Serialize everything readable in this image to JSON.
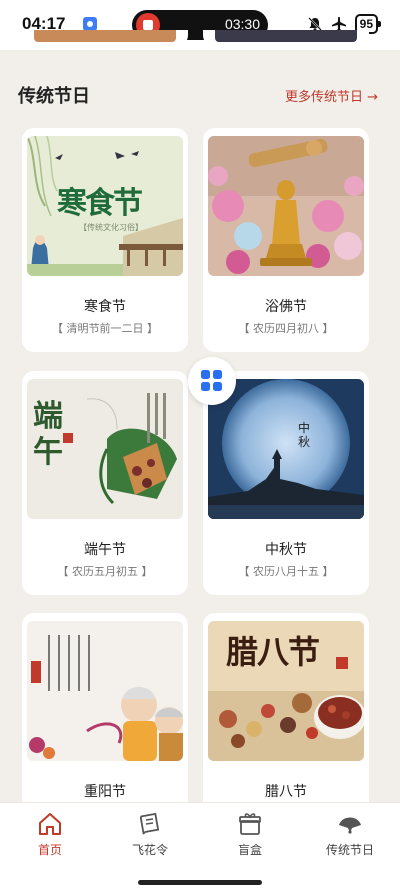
{
  "status_bar": {
    "time": "04:17",
    "recording_time": "03:30",
    "battery": "95",
    "icons": [
      "app-badge-icon",
      "record-stop-icon",
      "bell-off-icon",
      "airplane-icon",
      "battery-icon"
    ]
  },
  "section": {
    "title": "传统节日",
    "more_label": "更多传统节日 →"
  },
  "festivals": [
    {
      "name": "寒食节",
      "date": "【 清明节前一二日 】",
      "image_text": "寒食节",
      "image_sub": "【传统文化习俗】"
    },
    {
      "name": "浴佛节",
      "date": "【 农历四月初八 】"
    },
    {
      "name": "端午节",
      "date": "【 农历五月初五 】",
      "image_text": "端午"
    },
    {
      "name": "中秋节",
      "date": "【 农历八月十五 】",
      "image_text": "中秋"
    },
    {
      "name": "重阳节",
      "date": ""
    },
    {
      "name": "腊八节",
      "date": "",
      "image_text": "腊八节"
    }
  ],
  "bottom_nav": [
    {
      "label": "首页",
      "icon": "home-icon",
      "active": true
    },
    {
      "label": "飞花令",
      "icon": "book-icon",
      "active": false
    },
    {
      "label": "盲盒",
      "icon": "gift-box-icon",
      "active": false
    },
    {
      "label": "传统节日",
      "icon": "fan-icon",
      "active": false
    }
  ],
  "colors": {
    "accent": "#c0392b",
    "background": "#f2eee9",
    "card": "#ffffff",
    "float_button": "#2a6ff0"
  }
}
